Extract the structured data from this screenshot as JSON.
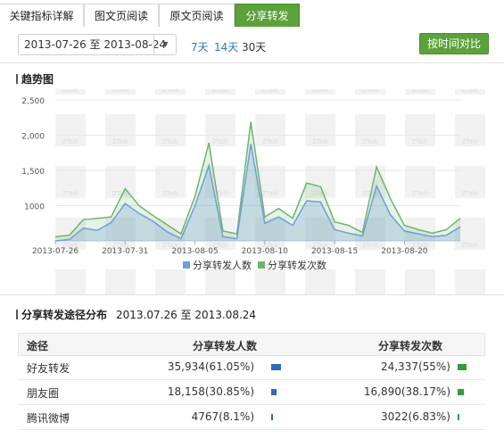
{
  "tabs": [
    {
      "label": "关键指标详解",
      "active": false
    },
    {
      "label": "图文页阅读",
      "active": false
    },
    {
      "label": "原文页阅读",
      "active": false
    },
    {
      "label": "分享转发",
      "active": true
    }
  ],
  "toolbar": {
    "date_range": "2013-07-26 至 2013-08-24",
    "quick_ranges": [
      "7天",
      "14天",
      "30天"
    ],
    "selected_range": "30天",
    "compare_button": "按时间对比"
  },
  "trend": {
    "title": "趋势图",
    "watermark": "ZTalk"
  },
  "chart_data": {
    "type": "area",
    "x": [
      "2013-07-26",
      "2013-07-27",
      "2013-07-28",
      "2013-07-29",
      "2013-07-30",
      "2013-07-31",
      "2013-08-01",
      "2013-08-02",
      "2013-08-03",
      "2013-08-04",
      "2013-08-05",
      "2013-08-06",
      "2013-08-07",
      "2013-08-08",
      "2013-08-09",
      "2013-08-10",
      "2013-08-11",
      "2013-08-12",
      "2013-08-13",
      "2013-08-14",
      "2013-08-15",
      "2013-08-16",
      "2013-08-17",
      "2013-08-18",
      "2013-08-19",
      "2013-08-20",
      "2013-08-21",
      "2013-08-22",
      "2013-08-23",
      "2013-08-24"
    ],
    "x_ticks": [
      "2013-07-26",
      "2013-07-31",
      "2013-08-05",
      "2013-08-10",
      "2013-08-15",
      "2013-08-20"
    ],
    "y_ticks": [
      1000,
      1500,
      2000,
      2500
    ],
    "y_tick_labels": [
      "1000",
      "1,500",
      "2,000",
      "2,500"
    ],
    "ylim": [
      500,
      2500
    ],
    "series": [
      {
        "name": "分享转发人数",
        "color": "#6f9fd8",
        "values": [
          500,
          520,
          680,
          650,
          760,
          1030,
          890,
          780,
          630,
          530,
          1000,
          1570,
          560,
          530,
          1880,
          750,
          840,
          720,
          1070,
          1050,
          660,
          610,
          570,
          1280,
          870,
          640,
          600,
          560,
          580,
          700
        ]
      },
      {
        "name": "分享转发次数",
        "color": "#6db56d",
        "values": [
          560,
          580,
          800,
          820,
          840,
          1240,
          1000,
          860,
          730,
          600,
          1130,
          1890,
          640,
          600,
          2190,
          840,
          960,
          820,
          1320,
          1270,
          770,
          720,
          620,
          1550,
          1100,
          720,
          660,
          610,
          660,
          820
        ]
      }
    ],
    "legend_position": "bottom"
  },
  "distribution": {
    "title": "分享转发途径分布",
    "date_range": "2013.07.26 至 2013.08.24",
    "columns": [
      "途径",
      "分享转发人数",
      "分享转发次数"
    ],
    "rows": [
      {
        "channel": "好友转发",
        "people": "35,934(61.05%)",
        "people_share": 0.6105,
        "times": "24,337(55%)",
        "times_share": 0.55
      },
      {
        "channel": "朋友圈",
        "people": "18,158(30.85%)",
        "people_share": 0.3085,
        "times": "16,890(38.17%)",
        "times_share": 0.3817
      },
      {
        "channel": "腾讯微博",
        "people": "4767(8.1%)",
        "people_share": 0.081,
        "times": "3022(6.83%)",
        "times_share": 0.0683
      }
    ]
  }
}
